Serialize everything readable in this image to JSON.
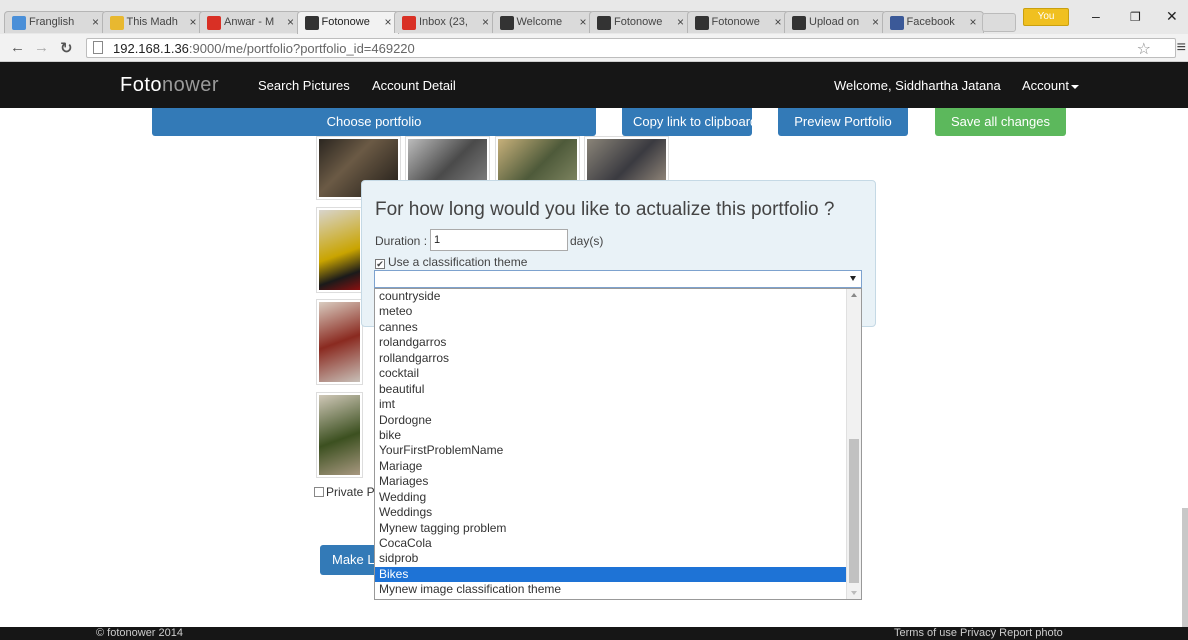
{
  "browser": {
    "tabs": [
      {
        "label": "Franglish",
        "fav_color": "#4a8fd8"
      },
      {
        "label": "This Madh",
        "fav_color": "#e8b830"
      },
      {
        "label": "Anwar - M",
        "fav_color": "#d93025"
      },
      {
        "label": "Fotonowe",
        "fav_color": "#333333"
      },
      {
        "label": "Inbox (23,",
        "fav_color": "#d93025"
      },
      {
        "label": "Welcome",
        "fav_color": "#333333"
      },
      {
        "label": "Fotonowe",
        "fav_color": "#333333"
      },
      {
        "label": "Fotonowe",
        "fav_color": "#333333"
      },
      {
        "label": "Upload on",
        "fav_color": "#333333"
      },
      {
        "label": "Facebook",
        "fav_color": "#3b5998"
      }
    ],
    "profile_label": "You",
    "url_host": "192.168.1.36",
    "url_path": ":9000/me/portfolio?portfolio_id=469220"
  },
  "navbar": {
    "brand_part1": "Foto",
    "brand_part2": "nower",
    "search_pictures": "Search Pictures",
    "account_detail": "Account Detail",
    "welcome": "Welcome, Siddhartha Jatana",
    "account": "Account"
  },
  "toolbar": {
    "choose_portfolio": "Choose portfolio",
    "copy_link": "Copy link to clipboard",
    "preview": "Preview Portfolio",
    "save_all": "Save all changes"
  },
  "private_label": "Private P",
  "make_link_label": "Make Li",
  "modal": {
    "title": "For how long would you like to actualize this portfolio ?",
    "duration_label": "Duration :",
    "duration_value": "1",
    "days_label": "day(s)",
    "use_theme_label": "Use a classification theme",
    "use_theme_checked": true
  },
  "dropdown": {
    "options": [
      "countryside",
      "meteo",
      "cannes",
      "rolandgarros",
      "rollandgarros",
      "cocktail",
      "beautiful",
      "imt",
      "Dordogne",
      "bike",
      "YourFirstProblemName",
      "Mariage",
      "Mariages",
      "Wedding",
      "Weddings",
      "Mynew tagging problem",
      "CocaCola",
      "sidprob",
      "Bikes",
      "Mynew image classification theme"
    ],
    "selected": "Bikes"
  },
  "footer": {
    "copyright": "© fotonower 2014",
    "links": "Terms of use Privacy Report photo"
  }
}
